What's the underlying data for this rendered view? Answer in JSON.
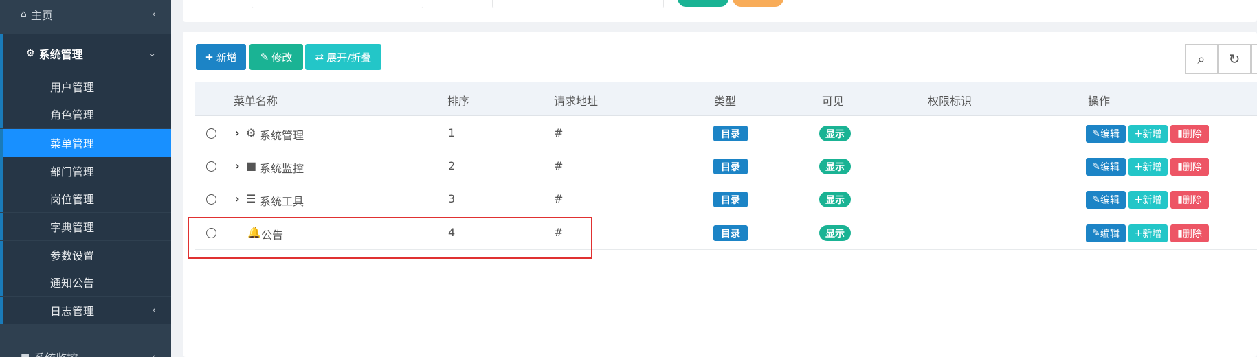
{
  "sidebar": {
    "home": "主页",
    "system": "系统管理",
    "sub_items": [
      {
        "label": "用户管理",
        "active": false
      },
      {
        "label": "角色管理",
        "active": false
      },
      {
        "label": "菜单管理",
        "active": true
      },
      {
        "label": "部门管理",
        "active": false
      },
      {
        "label": "岗位管理",
        "active": false
      },
      {
        "label": "字典管理",
        "active": false
      },
      {
        "label": "参数设置",
        "active": false
      },
      {
        "label": "通知公告",
        "active": false
      },
      {
        "label": "日志管理",
        "active": false
      }
    ],
    "monitor": "系统监控"
  },
  "toolbar": {
    "add": "新增",
    "edit": "修改",
    "expand": "展开/折叠"
  },
  "table": {
    "headers": [
      "菜单名称",
      "排序",
      "请求地址",
      "类型",
      "可见",
      "权限标识",
      "操作"
    ],
    "rows": [
      {
        "name": "系统管理",
        "icon": "gear-icon",
        "expandable": true,
        "order": "1",
        "url": "#",
        "type": "目录",
        "visible": "显示",
        "perm": ""
      },
      {
        "name": "系统监控",
        "icon": "video-icon",
        "expandable": true,
        "order": "2",
        "url": "#",
        "type": "目录",
        "visible": "显示",
        "perm": ""
      },
      {
        "name": "系统工具",
        "icon": "bars-icon",
        "expandable": true,
        "order": "3",
        "url": "#",
        "type": "目录",
        "visible": "显示",
        "perm": ""
      },
      {
        "name": "公告",
        "icon": "bell-icon",
        "expandable": false,
        "order": "4",
        "url": "#",
        "type": "目录",
        "visible": "显示",
        "perm": ""
      }
    ],
    "actions": {
      "edit": "编辑",
      "add": "新增",
      "delete": "删除"
    }
  },
  "colors": {
    "sidebar_bg": "#2f4050",
    "active": "#1890ff",
    "primary": "#1c84c6",
    "success": "#1ab394",
    "info": "#23c6c8",
    "danger": "#ed5565",
    "highlight": "#e03131"
  }
}
